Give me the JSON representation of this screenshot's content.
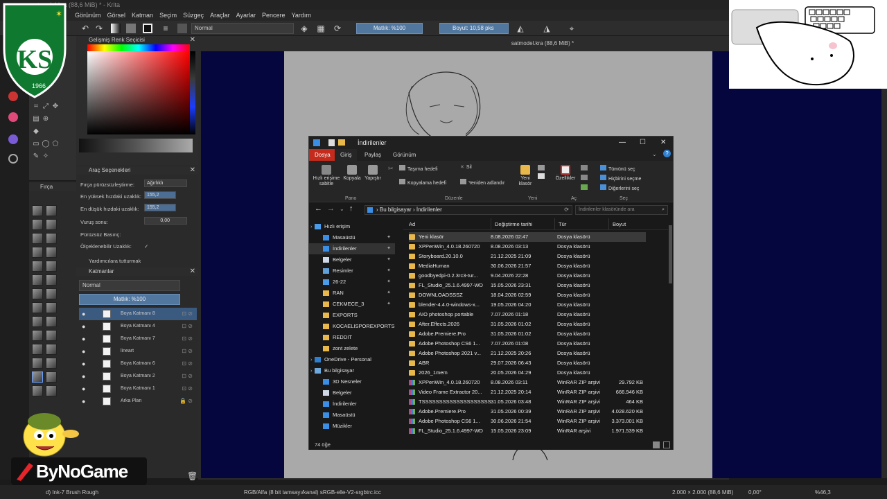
{
  "krita": {
    "title": "satmodel.kra (88,6 MiB) * - Krita",
    "menu": [
      "Görünüm",
      "Görsel",
      "Katman",
      "Seçim",
      "Süzgeç",
      "Araçlar",
      "Ayarlar",
      "Pencere",
      "Yardım"
    ],
    "toolbar": {
      "blend_mode": "Normal",
      "opacity": "Matlık: %100",
      "size": "Boyut: 10,58 pks"
    },
    "doc_tab": "satmodel.kra (88,6 MiB) *",
    "color_panel_title": "Gelişmiş Renk Seçicisi",
    "tool_options": {
      "title": "Araç Seçenekleri",
      "rows": [
        {
          "label": "Fırça pürüzsüzleştirme:",
          "value": "Ağırlıklı"
        },
        {
          "label": "En yüksek hızdaki uzaklık:",
          "value": "155,2"
        },
        {
          "label": "En düşük hızdaki uzaklık:",
          "value": "155,2"
        },
        {
          "label": "Vuruş sonu:",
          "value": "0,00"
        },
        {
          "label": "Pürüzsüz Basınç:",
          "value": ""
        },
        {
          "label": "Ölçeklenebilir Uzaklık:",
          "value": "✓"
        }
      ],
      "helpers": "Yardımcılara tutturmak"
    },
    "brush_panel_title": "Fırça",
    "layers": {
      "title": "Katmanlar",
      "blend": "Normal",
      "opacity": "Matlık: %100",
      "items": [
        "Boya Katmanı 8",
        "Boya Katmanı 4",
        "Boya Katmanı 7",
        "lineart",
        "Boya Katmanı 6",
        "Boya Katmanı 2",
        "Boya Katmanı 1",
        "Arka Plan"
      ]
    },
    "status": {
      "brush": "d) Ink-7 Brush Rough",
      "color": "RGB/Alfa (8 bit tamsayı/kanal) sRGB-elle-V2-srgbtrc.icc",
      "size": "2.000 × 2.000 (88,6 MiB)",
      "rotation": "0,00°",
      "zoom": "%46,3"
    }
  },
  "overlays": {
    "logo_text": "KS",
    "logo_year": "1966",
    "brand": "ByNoGame"
  },
  "explorer": {
    "title": "İndirilenler",
    "tabs": [
      "Dosya",
      "Giriş",
      "Paylaş",
      "Görünüm"
    ],
    "ribbon": {
      "pano": {
        "label": "Pano",
        "buttons": [
          "Hızlı erişime sabitle",
          "Kopyala",
          "Yapıştır"
        ]
      },
      "duzenle": {
        "label": "Düzenle",
        "buttons": [
          "Taşıma hedefi",
          "Kopyalama hedefi",
          "Sil",
          "Yeniden adlandır"
        ]
      },
      "yeni": {
        "label": "Yeni",
        "buttons": [
          "Yeni klasör"
        ]
      },
      "ac": {
        "label": "Aç",
        "buttons": [
          "Özellikler"
        ]
      },
      "sec": {
        "label": "Seç",
        "buttons": [
          "Tümünü seç",
          "Hiçbirini seçme",
          "Diğerlerini seç"
        ]
      }
    },
    "address": [
      "Bu bilgisayar",
      "İndirilenler"
    ],
    "search_placeholder": "İndirilenler klasöründe ara",
    "nav": [
      {
        "label": "Hızlı erişim",
        "type": "star"
      },
      {
        "label": "Masaüstü",
        "type": "blue",
        "pin": true
      },
      {
        "label": "İndirilenler",
        "type": "down",
        "pin": true
      },
      {
        "label": "Belgeler",
        "type": "doc",
        "pin": true
      },
      {
        "label": "Resimler",
        "type": "pic",
        "pin": true
      },
      {
        "label": "26-22",
        "type": "star",
        "pin": true
      },
      {
        "label": "RAN",
        "type": "fold",
        "pin": true
      },
      {
        "label": "CEKMECE_3",
        "type": "fold",
        "pin": true
      },
      {
        "label": "EXPORTS",
        "type": "fold",
        "pin": false
      },
      {
        "label": "KOCAELISPOREXPORTS",
        "type": "fold",
        "pin": false
      },
      {
        "label": "REDDIT",
        "type": "fold",
        "pin": false
      },
      {
        "label": "zont zelete",
        "type": "fold",
        "pin": false
      },
      {
        "label": "OneDrive - Personal",
        "type": "cloud",
        "pin": false
      },
      {
        "label": "Bu bilgisayar",
        "type": "pc",
        "pin": false
      },
      {
        "label": "3D Nesneler",
        "type": "blue",
        "pin": false
      },
      {
        "label": "Belgeler",
        "type": "doc",
        "pin": false
      },
      {
        "label": "İndirilenler",
        "type": "down",
        "pin": false
      },
      {
        "label": "Masaüstü",
        "type": "blue",
        "pin": false
      },
      {
        "label": "Müzikler",
        "type": "blue",
        "pin": false
      }
    ],
    "columns": [
      "Ad",
      "Değiştirme tarihi",
      "Tür",
      "Boyut"
    ],
    "files": [
      {
        "name": "Yeni klasör",
        "date": "8.08.2026 02:47",
        "type": "Dosya klasörü",
        "size": "",
        "kind": "fold"
      },
      {
        "name": "XPPenWin_4.0.18.260720",
        "date": "8.08.2026 03:13",
        "type": "Dosya klasörü",
        "size": "",
        "kind": "fold"
      },
      {
        "name": "Storyboard.20.10.0",
        "date": "21.12.2025 21:09",
        "type": "Dosya klasörü",
        "size": "",
        "kind": "fold"
      },
      {
        "name": "MediaHuman",
        "date": "30.06.2026 21:57",
        "type": "Dosya klasörü",
        "size": "",
        "kind": "fold"
      },
      {
        "name": "goodbyedpi-0.2.3rc3-tur...",
        "date": "9.04.2026 22:28",
        "type": "Dosya klasörü",
        "size": "",
        "kind": "fold"
      },
      {
        "name": "FL_Studio_25.1.6.4997-WD",
        "date": "15.05.2026 23:31",
        "type": "Dosya klasörü",
        "size": "",
        "kind": "fold"
      },
      {
        "name": "DOWNLOADSSSZ",
        "date": "18.04.2026 02:59",
        "type": "Dosya klasörü",
        "size": "",
        "kind": "fold"
      },
      {
        "name": "blender-4.4.0-windows-x...",
        "date": "19.05.2026 04:20",
        "type": "Dosya klasörü",
        "size": "",
        "kind": "fold"
      },
      {
        "name": "AIO photoshop portable",
        "date": "7.07.2026 01:18",
        "type": "Dosya klasörü",
        "size": "",
        "kind": "fold"
      },
      {
        "name": "After.Effects.2026",
        "date": "31.05.2026 01:02",
        "type": "Dosya klasörü",
        "size": "",
        "kind": "fold"
      },
      {
        "name": "Adobe.Premiere.Pro",
        "date": "31.05.2026 01:02",
        "type": "Dosya klasörü",
        "size": "",
        "kind": "fold"
      },
      {
        "name": "Adobe Photoshop CS6 1...",
        "date": "7.07.2026 01:08",
        "type": "Dosya klasörü",
        "size": "",
        "kind": "fold"
      },
      {
        "name": "Adobe Photoshop 2021 v...",
        "date": "21.12.2025 20:26",
        "type": "Dosya klasörü",
        "size": "",
        "kind": "fold"
      },
      {
        "name": "ABR",
        "date": "29.07.2026 06:43",
        "type": "Dosya klasörü",
        "size": "",
        "kind": "fold"
      },
      {
        "name": "2026_1mem",
        "date": "20.05.2026 04:29",
        "type": "Dosya klasörü",
        "size": "",
        "kind": "fold"
      },
      {
        "name": "XPPenWin_4.0.18.260720",
        "date": "8.08.2026 03:11",
        "type": "WinRAR ZIP arşivi",
        "size": "29.792 KB",
        "kind": "zip"
      },
      {
        "name": "Video Frame Extractor 20...",
        "date": "21.12.2025 20:14",
        "type": "WinRAR ZIP arşivi",
        "size": "666.946 KB",
        "kind": "zip"
      },
      {
        "name": "TSSSSSSSSSSSSSSSSSSSS...",
        "date": "31.05.2026 03:48",
        "type": "WinRAR ZIP arşivi",
        "size": "464 KB",
        "kind": "zip"
      },
      {
        "name": "Adobe.Premiere.Pro",
        "date": "31.05.2026 00:39",
        "type": "WinRAR ZIP arşivi",
        "size": "4.028.620 KB",
        "kind": "zip"
      },
      {
        "name": "Adobe Photoshop CS6 1...",
        "date": "30.06.2026 21:54",
        "type": "WinRAR ZIP arşivi",
        "size": "3.373.001 KB",
        "kind": "zip"
      },
      {
        "name": "FL_Studio_25.1.6.4997-WD",
        "date": "15.05.2026 23:09",
        "type": "WinRAR arşivi",
        "size": "1.971.539 KB",
        "kind": "zip"
      }
    ],
    "item_count": "74 öğe"
  }
}
